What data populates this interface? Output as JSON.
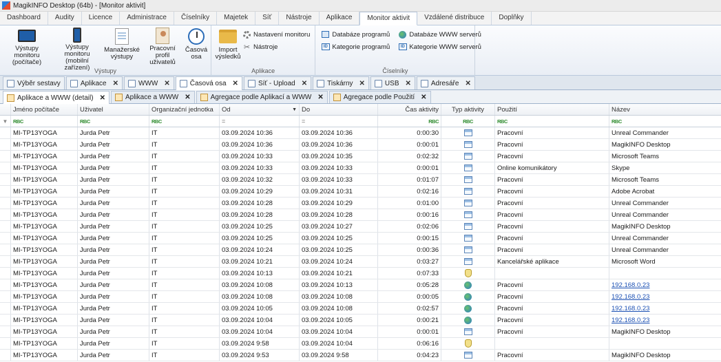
{
  "window": {
    "title": "MagikINFO Desktop (64b) - [Monitor aktivit]"
  },
  "menu": [
    "Dashboard",
    "Audity",
    "Licence",
    "Administrace",
    "Číselníky",
    "Majetek",
    "Síť",
    "Nástroje",
    "Aplikace",
    "Monitor aktivit",
    "Vzdálené distribuce",
    "Doplňky"
  ],
  "menu_active_index": 9,
  "ribbon": {
    "vystupy": {
      "label": "Výstupy",
      "buttons": [
        {
          "label": "Výstupy monitoru (počítače)",
          "icon": "monitor-icon"
        },
        {
          "label": "Výstupy monitoru (mobilní zařízení)",
          "icon": "phone-icon"
        },
        {
          "label": "Manažerské výstupy",
          "icon": "report-icon"
        },
        {
          "label": "Pracovní profil uživatelů",
          "icon": "user-profile-icon"
        },
        {
          "label": "Časová osa",
          "icon": "clock-icon"
        }
      ]
    },
    "aplikace": {
      "label": "Aplikace",
      "import": "Import výsledků",
      "settings": "Nastavení monitoru",
      "tools": "Nástroje"
    },
    "ciselniky": {
      "label": "Číselníky",
      "db_programs": "Databáze programů",
      "cat_programs": "Kategorie programů",
      "db_www": "Databáze WWW serverů",
      "cat_www": "Kategorie WWW serverů"
    }
  },
  "tabs": [
    "Výběr sestavy",
    "Aplikace",
    "WWW",
    "Časová osa",
    "Síť - Upload",
    "Tiskárny",
    "USB",
    "Adresáře"
  ],
  "tabs_active_index": 3,
  "subtabs": [
    "Aplikace a WWW (detail)",
    "Aplikace a WWW",
    "Agregace podle Aplikací a WWW",
    "Agregace podle Použití"
  ],
  "subtabs_active_index": 0,
  "grid": {
    "columns": [
      "Jméno počítače",
      "Uživatel",
      "Organizační jednotka",
      "Od",
      "Do",
      "Čas aktivity",
      "Typ aktivity",
      "Použití",
      "Název"
    ],
    "filter_marks": [
      "RBC",
      "RBC",
      "RBC",
      "=",
      "=",
      "RBC",
      "RBC",
      "RBC",
      "RBC"
    ],
    "rows": [
      [
        "MI-TP13YOGA",
        "Jurda Petr",
        "IT",
        "03.09.2024 10:36",
        "03.09.2024 10:36",
        "0:00:30",
        "app",
        "Pracovní",
        "Unreal Commander"
      ],
      [
        "MI-TP13YOGA",
        "Jurda Petr",
        "IT",
        "03.09.2024 10:36",
        "03.09.2024 10:36",
        "0:00:01",
        "app",
        "Pracovní",
        "MagikINFO Desktop"
      ],
      [
        "MI-TP13YOGA",
        "Jurda Petr",
        "IT",
        "03.09.2024 10:33",
        "03.09.2024 10:35",
        "0:02:32",
        "app",
        "Pracovní",
        "Microsoft Teams"
      ],
      [
        "MI-TP13YOGA",
        "Jurda Petr",
        "IT",
        "03.09.2024 10:33",
        "03.09.2024 10:33",
        "0:00:01",
        "app",
        "Online komunikátory",
        "Skype"
      ],
      [
        "MI-TP13YOGA",
        "Jurda Petr",
        "IT",
        "03.09.2024 10:32",
        "03.09.2024 10:33",
        "0:01:07",
        "app",
        "Pracovní",
        "Microsoft Teams"
      ],
      [
        "MI-TP13YOGA",
        "Jurda Petr",
        "IT",
        "03.09.2024 10:29",
        "03.09.2024 10:31",
        "0:02:16",
        "app",
        "Pracovní",
        "Adobe Acrobat"
      ],
      [
        "MI-TP13YOGA",
        "Jurda Petr",
        "IT",
        "03.09.2024 10:28",
        "03.09.2024 10:29",
        "0:01:00",
        "app",
        "Pracovní",
        "Unreal Commander"
      ],
      [
        "MI-TP13YOGA",
        "Jurda Petr",
        "IT",
        "03.09.2024 10:28",
        "03.09.2024 10:28",
        "0:00:16",
        "app",
        "Pracovní",
        "Unreal Commander"
      ],
      [
        "MI-TP13YOGA",
        "Jurda Petr",
        "IT",
        "03.09.2024 10:25",
        "03.09.2024 10:27",
        "0:02:06",
        "app",
        "Pracovní",
        "MagikINFO Desktop"
      ],
      [
        "MI-TP13YOGA",
        "Jurda Petr",
        "IT",
        "03.09.2024 10:25",
        "03.09.2024 10:25",
        "0:00:15",
        "app",
        "Pracovní",
        "Unreal Commander"
      ],
      [
        "MI-TP13YOGA",
        "Jurda Petr",
        "IT",
        "03.09.2024 10:24",
        "03.09.2024 10:25",
        "0:00:36",
        "app",
        "Pracovní",
        "Unreal Commander"
      ],
      [
        "MI-TP13YOGA",
        "Jurda Petr",
        "IT",
        "03.09.2024 10:21",
        "03.09.2024 10:24",
        "0:03:27",
        "app",
        "Kancelářské aplikace",
        "Microsoft Word"
      ],
      [
        "MI-TP13YOGA",
        "Jurda Petr",
        "IT",
        "03.09.2024 10:13",
        "03.09.2024 10:21",
        "0:07:33",
        "idle",
        "",
        ""
      ],
      [
        "MI-TP13YOGA",
        "Jurda Petr",
        "IT",
        "03.09.2024 10:08",
        "03.09.2024 10:13",
        "0:05:28",
        "web",
        "Pracovní",
        "192.168.0.23"
      ],
      [
        "MI-TP13YOGA",
        "Jurda Petr",
        "IT",
        "03.09.2024 10:08",
        "03.09.2024 10:08",
        "0:00:05",
        "web",
        "Pracovní",
        "192.168.0.23"
      ],
      [
        "MI-TP13YOGA",
        "Jurda Petr",
        "IT",
        "03.09.2024 10:05",
        "03.09.2024 10:08",
        "0:02:57",
        "web",
        "Pracovní",
        "192.168.0.23"
      ],
      [
        "MI-TP13YOGA",
        "Jurda Petr",
        "IT",
        "03.09.2024 10:04",
        "03.09.2024 10:05",
        "0:00:21",
        "web",
        "Pracovní",
        "192.168.0.23"
      ],
      [
        "MI-TP13YOGA",
        "Jurda Petr",
        "IT",
        "03.09.2024 10:04",
        "03.09.2024 10:04",
        "0:00:01",
        "app",
        "Pracovní",
        "MagikINFO Desktop"
      ],
      [
        "MI-TP13YOGA",
        "Jurda Petr",
        "IT",
        "03.09.2024 9:58",
        "03.09.2024 10:04",
        "0:06:16",
        "idle",
        "",
        ""
      ],
      [
        "MI-TP13YOGA",
        "Jurda Petr",
        "IT",
        "03.09.2024 9:53",
        "03.09.2024 9:58",
        "0:04:23",
        "app",
        "Pracovní",
        "MagikINFO Desktop"
      ]
    ]
  }
}
